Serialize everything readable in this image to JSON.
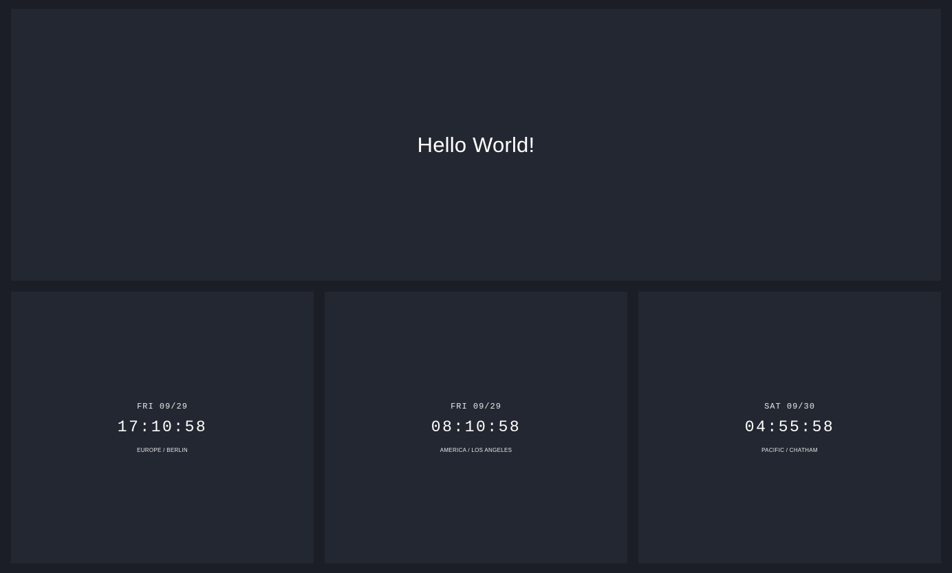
{
  "hero": {
    "text": "Hello World!"
  },
  "clocks": [
    {
      "date": "FRI 09/29",
      "time": "17:10:58",
      "zone": "EUROPE / BERLIN"
    },
    {
      "date": "FRI 09/29",
      "time": "08:10:58",
      "zone": "AMERICA / LOS ANGELES"
    },
    {
      "date": "SAT 09/30",
      "time": "04:55:58",
      "zone": "PACIFIC / CHATHAM"
    }
  ],
  "colors": {
    "background": "#1b1e26",
    "panel": "#232731",
    "text": "#ffffff"
  }
}
